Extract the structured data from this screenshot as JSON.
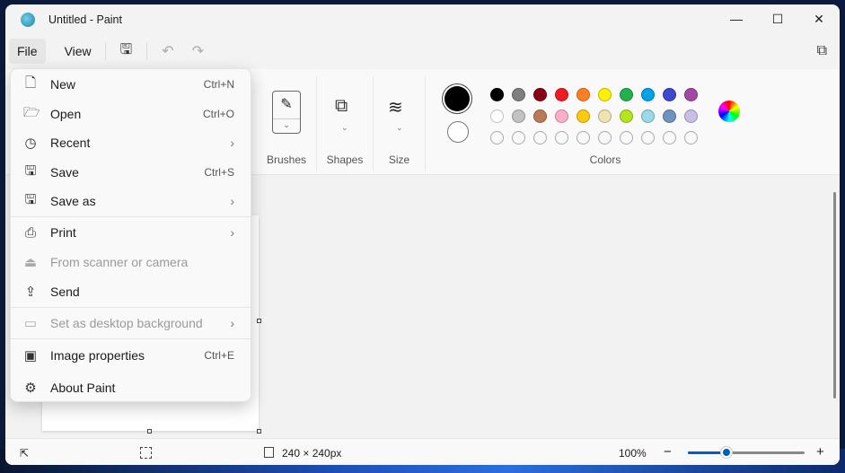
{
  "window": {
    "title": "Untitled - Paint",
    "minimize": "—",
    "maximize": "☐",
    "close": "✕"
  },
  "menubar": {
    "file": "File",
    "view": "View"
  },
  "ribbon": {
    "brushes": "Brushes",
    "shapes": "Shapes",
    "size": "Size",
    "colors": "Colors"
  },
  "colors": {
    "primary": "#000000",
    "secondary": "#ffffff",
    "row1": [
      "#000000",
      "#7f7f7f",
      "#880015",
      "#ed1c24",
      "#ff7f27",
      "#fff200",
      "#22b14c",
      "#00a2e8",
      "#3f48cc",
      "#a349a4"
    ],
    "row2": [
      "#ffffff",
      "#c3c3c3",
      "#b97a57",
      "#ffaec9",
      "#ffc90e",
      "#efe4b0",
      "#b5e61d",
      "#99d9ea",
      "#7092be",
      "#c8bfe7"
    ]
  },
  "file_menu": [
    {
      "label": "New",
      "shortcut": "Ctrl+N",
      "icon": "🗋"
    },
    {
      "label": "Open",
      "shortcut": "Ctrl+O",
      "icon": "🗁"
    },
    {
      "label": "Recent",
      "chevron": "›",
      "icon": "◷"
    },
    {
      "label": "Save",
      "shortcut": "Ctrl+S",
      "icon": "🖫"
    },
    {
      "label": "Save as",
      "chevron": "›",
      "icon": "🖫"
    },
    {
      "label": "Print",
      "chevron": "›",
      "icon": "⎙"
    },
    {
      "label": "From scanner or camera",
      "icon": "⏏"
    },
    {
      "label": "Send",
      "icon": "⇪"
    },
    {
      "label": "Set as desktop background",
      "chevron": "›",
      "icon": "▭"
    },
    {
      "label": "Image properties",
      "shortcut": "Ctrl+E",
      "icon": "▣"
    },
    {
      "label": "About Paint",
      "icon": "⚙"
    }
  ],
  "status": {
    "canvas_size": "240 × 240px",
    "zoom": "100%",
    "zoom_minus": "−",
    "zoom_plus": "+",
    "zoom_fraction": 0.33
  }
}
